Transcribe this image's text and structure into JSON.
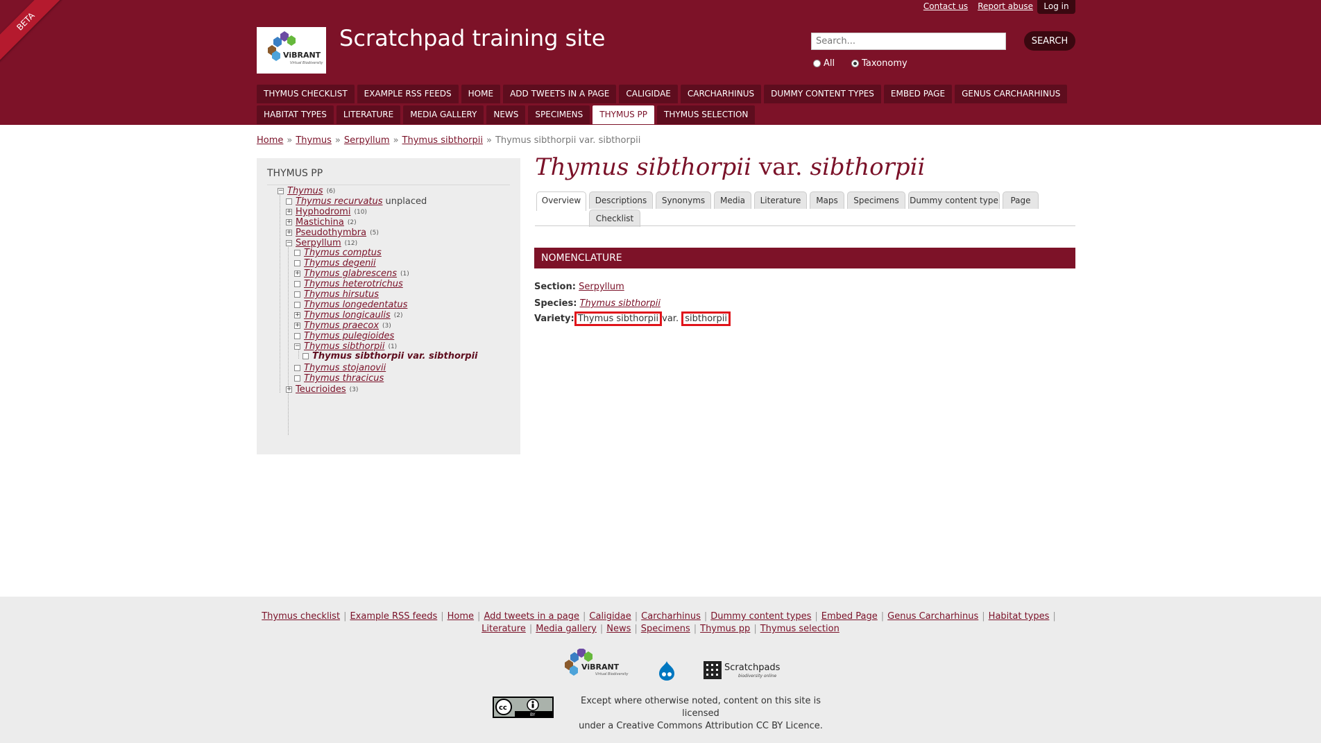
{
  "header": {
    "beta": "BETA",
    "contact": "Contact us",
    "report": "Report abuse",
    "login": "Log in",
    "site_title": "Scratchpad training site",
    "search_placeholder": "Search...",
    "search_button": "SEARCH",
    "radio_all": "All",
    "radio_taxonomy": "Taxonomy",
    "logo_text": "ViBRANT",
    "logo_sub": "Virtual Biodiversity"
  },
  "menu": {
    "row1": [
      "THYMUS CHECKLIST",
      "EXAMPLE RSS FEEDS",
      "HOME",
      "ADD TWEETS IN A PAGE",
      "CALIGIDAE",
      "CARCHARHINUS",
      "DUMMY CONTENT TYPES",
      "EMBED PAGE",
      "GENUS CARCHARHINUS"
    ],
    "row2": [
      "HABITAT TYPES",
      "LITERATURE",
      "MEDIA GALLERY",
      "NEWS",
      "SPECIMENS",
      "THYMUS PP",
      "THYMUS SELECTION"
    ]
  },
  "breadcrumb": {
    "items": [
      "Home",
      "Thymus",
      "Serpyllum",
      "Thymus sibthorpii"
    ],
    "current": "Thymus sibthorpii var. sibthorpii",
    "sep": "»"
  },
  "sidebar": {
    "title": "THYMUS PP",
    "tree": [
      {
        "label": "Thymus",
        "count": "(6)",
        "italic": true,
        "box": "minus"
      },
      {
        "label": "Thymus recurvatus",
        "extra": "unplaced",
        "italic": true,
        "box": "empty"
      },
      {
        "label": "Hyphodromi",
        "count": "(10)",
        "box": "plus"
      },
      {
        "label": "Mastichina",
        "count": "(2)",
        "box": "plus"
      },
      {
        "label": "Pseudothymbra",
        "count": "(5)",
        "box": "plus"
      },
      {
        "label": "Serpyllum",
        "count": "(12)",
        "box": "minus"
      },
      {
        "label": "Thymus comptus",
        "italic": true,
        "box": "empty"
      },
      {
        "label": "Thymus degenii",
        "italic": true,
        "box": "empty"
      },
      {
        "label": "Thymus glabrescens",
        "count": "(1)",
        "italic": true,
        "box": "plus"
      },
      {
        "label": "Thymus heterotrichus",
        "italic": true,
        "box": "empty"
      },
      {
        "label": "Thymus hirsutus",
        "italic": true,
        "box": "empty"
      },
      {
        "label": "Thymus longedentatus",
        "italic": true,
        "box": "empty"
      },
      {
        "label": "Thymus longicaulis",
        "count": "(2)",
        "italic": true,
        "box": "plus"
      },
      {
        "label": "Thymus praecox",
        "count": "(3)",
        "italic": true,
        "box": "plus"
      },
      {
        "label": "Thymus pulegioides",
        "italic": true,
        "box": "empty"
      },
      {
        "label": "Thymus sibthorpii",
        "count": "(1)",
        "italic": true,
        "box": "minus"
      },
      {
        "label": "Thymus sibthorpii var. sibthorpii",
        "current": true,
        "box": "empty"
      },
      {
        "label": "Thymus stojanovii",
        "italic": true,
        "box": "empty"
      },
      {
        "label": "Thymus thracicus",
        "italic": true,
        "box": "empty"
      },
      {
        "label": "Teucrioides",
        "count": "(3)",
        "box": "plus"
      }
    ]
  },
  "main": {
    "title_genus": "Thymus sibthorpii",
    "title_rank": "var.",
    "title_epithet": "sibthorpii",
    "tabs": [
      "Overview",
      "Descriptions",
      "Synonyms",
      "Media",
      "Literature",
      "Maps",
      "Specimens",
      "Dummy content type",
      "Page",
      "Checklist"
    ],
    "section_bar": "NOMENCLATURE",
    "section_label": "Section:",
    "section_value": "Serpyllum",
    "species_label": "Species:",
    "species_value": "Thymus sibthorpii",
    "variety_label": "Variety:",
    "variety_part1": "Thymus sibthorpii",
    "variety_rank": "var.",
    "variety_part2": "sibthorpii"
  },
  "footer": {
    "links_line1": [
      "Thymus checklist",
      "Example RSS feeds",
      "Home",
      "Add tweets in a page",
      "Caligidae",
      "Carcharhinus",
      "Dummy content types",
      "Embed Page",
      "Genus Carcharhinus",
      "Habitat types"
    ],
    "links_line2": [
      "Literature",
      "Media gallery",
      "News",
      "Specimens",
      "Thymus pp",
      "Thymus selection"
    ],
    "logo_vibrant": "ViBRANT",
    "logo_vibrant_sub": "Virtual Biodiversity",
    "logo_scratchpads": "Scratchpads",
    "logo_scratchpads_sub": "biodiversity online",
    "licence_line1": "Except where otherwise noted, content on this site is licensed",
    "licence_line2": "under a Creative Commons Attribution CC BY Licence.",
    "cc_text": "cc",
    "by_text": "BY"
  },
  "colors": {
    "brand": "#7d1228",
    "dark": "#3a0810",
    "highlight": "#e0141b"
  }
}
